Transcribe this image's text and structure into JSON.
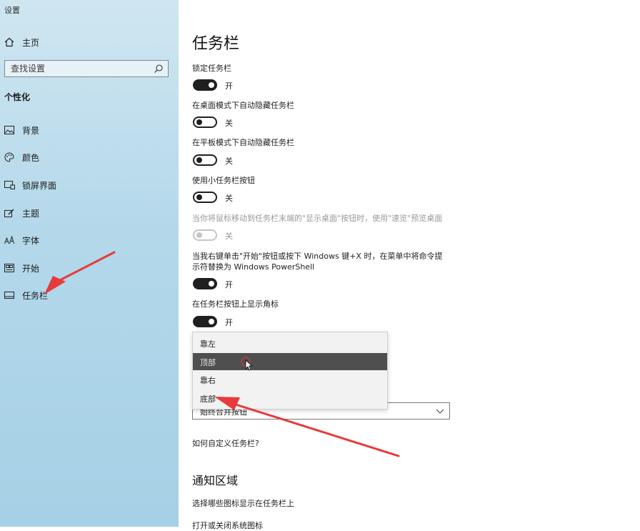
{
  "window": {
    "title": "设置"
  },
  "sidebar": {
    "home_label": "主页",
    "search_placeholder": "查找设置",
    "section_header": "个性化",
    "items": [
      {
        "label": "背景",
        "icon": "picture-icon"
      },
      {
        "label": "颜色",
        "icon": "palette-icon"
      },
      {
        "label": "锁屏界面",
        "icon": "lock-screen-icon"
      },
      {
        "label": "主题",
        "icon": "theme-icon"
      },
      {
        "label": "字体",
        "icon": "font-icon"
      },
      {
        "label": "开始",
        "icon": "start-icon"
      },
      {
        "label": "任务栏",
        "icon": "taskbar-icon",
        "selected": true
      }
    ]
  },
  "main": {
    "title": "任务栏",
    "settings": [
      {
        "label": "锁定任务栏",
        "state": "开",
        "on": true
      },
      {
        "label": "在桌面模式下自动隐藏任务栏",
        "state": "关",
        "on": false
      },
      {
        "label": "在平板模式下自动隐藏任务栏",
        "state": "关",
        "on": false
      },
      {
        "label": "使用小任务栏按钮",
        "state": "关",
        "on": false
      },
      {
        "label": "当你将鼠标移动到任务栏末端的\"显示桌面\"按钮时，使用\"速览\"预览桌面",
        "state": "关",
        "on": false,
        "disabled": true
      },
      {
        "label_line1": "当我右键单击\"开始\"按钮或按下 Windows 键+X 时，在菜单中将命令提",
        "label_line2": "示符替换为 Windows PowerShell",
        "state": "开",
        "on": true
      },
      {
        "label": "在任务栏按钮上显示角标",
        "state": "开",
        "on": true
      }
    ],
    "position_dropdown": {
      "options": [
        "靠左",
        "顶部",
        "靠右",
        "底部"
      ],
      "highlighted": "顶部"
    },
    "combine_combo_value": "始终合并按钮",
    "customize_link": "如何自定义任务栏?",
    "notification_area": {
      "heading": "通知区域",
      "link1": "选择哪些图标显示在任务栏上",
      "link2": "打开或关闭系统图标"
    }
  },
  "colors": {
    "sidebar_bg": "#b3d8ea",
    "toggle_on": "#1f1f1f",
    "dropdown_highlight": "#4f4f4f",
    "annotation_arrow": "#e83a3a"
  }
}
